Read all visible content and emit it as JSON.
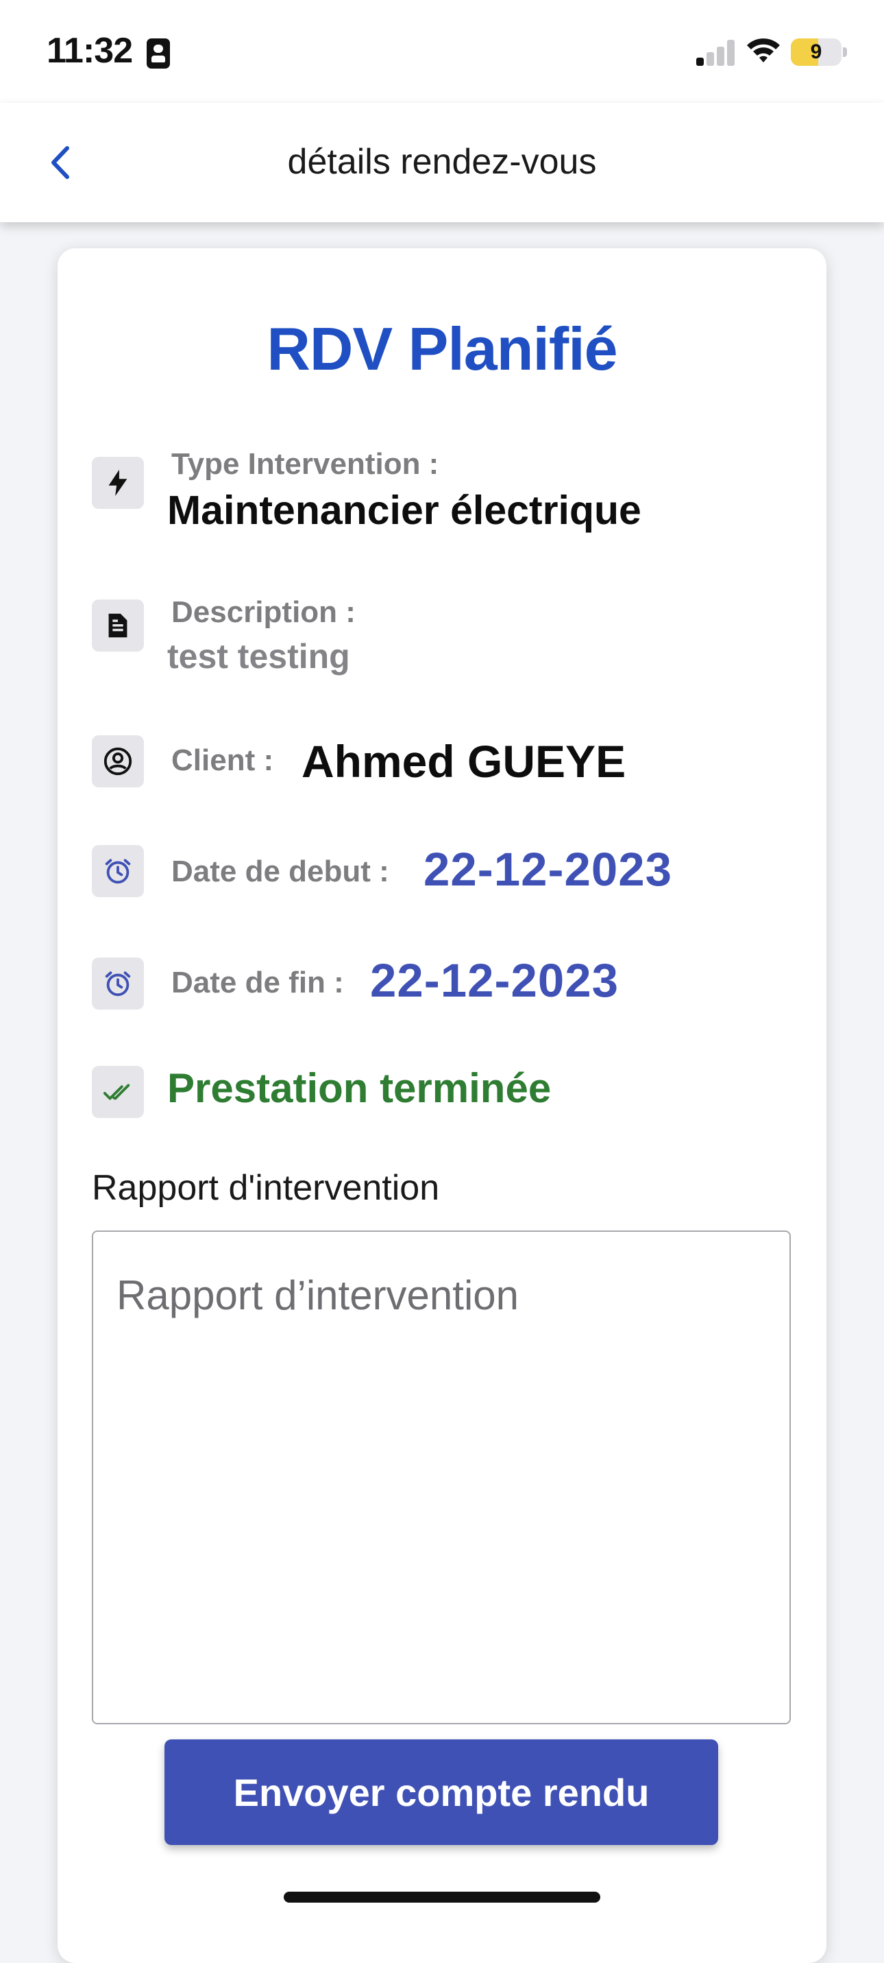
{
  "status_bar": {
    "time": "11:32",
    "battery_level": "9",
    "battery_color": "#f3d046"
  },
  "header": {
    "title": "détails rendez-vous",
    "back_icon": "chevron-left-icon"
  },
  "card": {
    "title": "RDV Planifié",
    "title_color": "#1f4fc2",
    "fields": {
      "type": {
        "icon": "bolt-icon",
        "label": "Type Intervention :",
        "value": "Maintenancier électrique"
      },
      "description": {
        "icon": "document-icon",
        "label": "Description :",
        "value": "test testing"
      },
      "client": {
        "icon": "user-circle-icon",
        "label": "Client :",
        "value": "Ahmed GUEYE"
      },
      "start_date": {
        "icon": "alarm-clock-icon",
        "label": "Date de debut :",
        "value": "22-12-2023"
      },
      "end_date": {
        "icon": "alarm-clock-icon",
        "label": "Date de fin :",
        "value": "22-12-2023"
      },
      "status": {
        "icon": "double-check-icon",
        "value": "Prestation terminée",
        "color": "#2e7d32"
      }
    },
    "report": {
      "label": "Rapport d'intervention",
      "placeholder": "Rapport d’intervention",
      "value": ""
    },
    "submit_label": "Envoyer compte rendu",
    "accent_color": "#3f51b5"
  }
}
